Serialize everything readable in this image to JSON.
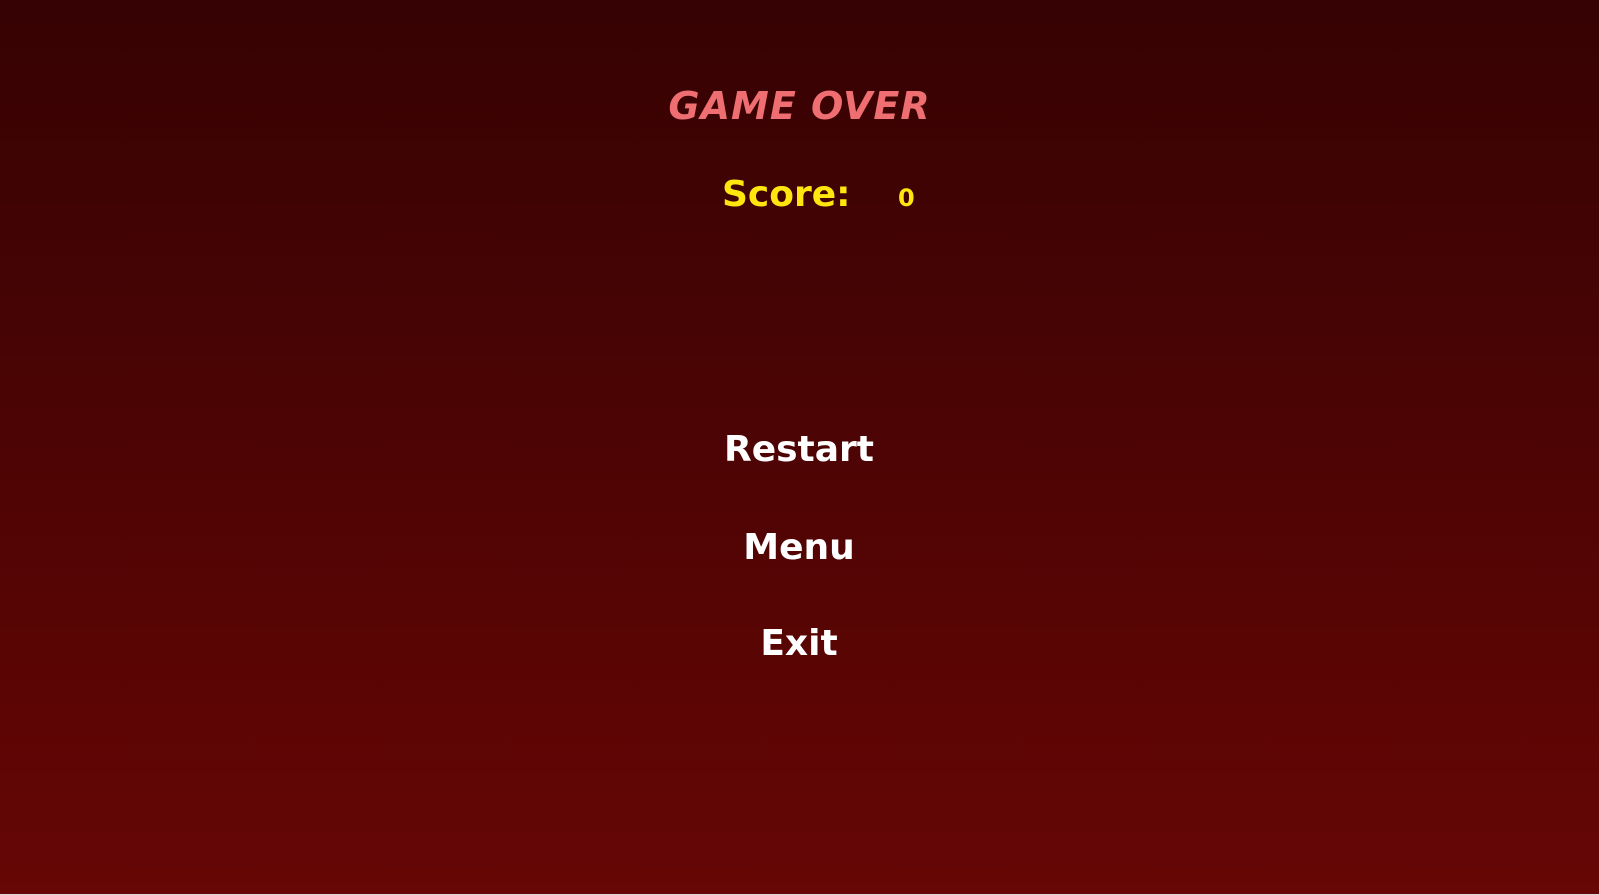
{
  "game_over": {
    "title": "GAME OVER",
    "score_label": "Score:",
    "score_value": "0",
    "buttons": {
      "restart": "Restart",
      "menu": "Menu",
      "exit": "Exit"
    }
  },
  "colors": {
    "background_top": "#360203",
    "background_bottom": "#660605",
    "title": "#ef6e72",
    "score": "#ffe60f",
    "button_text": "#ffffff"
  }
}
